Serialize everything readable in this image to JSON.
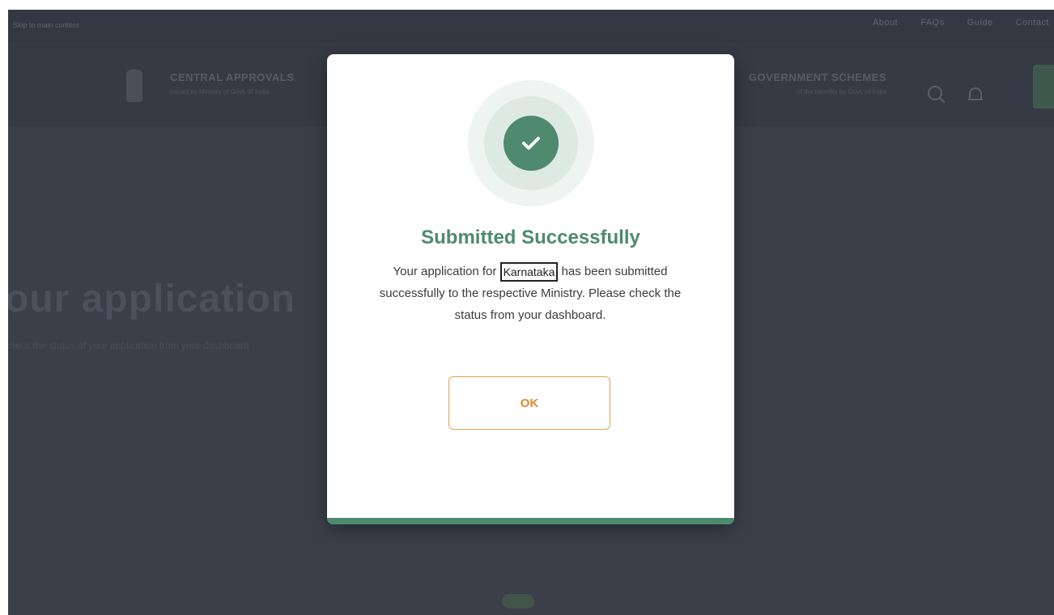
{
  "topbar": {
    "skip_text": "Skip to main content",
    "links": [
      "About",
      "FAQs",
      "Guide",
      "Contact"
    ]
  },
  "header": {
    "left_title": "CENTRAL APPROVALS",
    "left_subtitle": "issued by Ministry of Govt. of India",
    "right_title": "GOVERNMENT SCHEMES",
    "right_subtitle": "of the benefits by Govt. of India"
  },
  "background": {
    "heading": "our application",
    "subtext": "check the status of your application from your dashboard"
  },
  "modal": {
    "title": "Submitted Successfully",
    "message_prefix": "Your application for",
    "highlighted": "Karnataka",
    "message_suffix": "has been submitted successfully to the respective Ministry. Please check the status from your dashboard.",
    "ok_label": "OK",
    "icon": "check-circle-icon"
  },
  "colors": {
    "overlay_bg": "#3a3f49",
    "success_green": "#4e8a6d",
    "ok_orange": "#e08a2a"
  }
}
